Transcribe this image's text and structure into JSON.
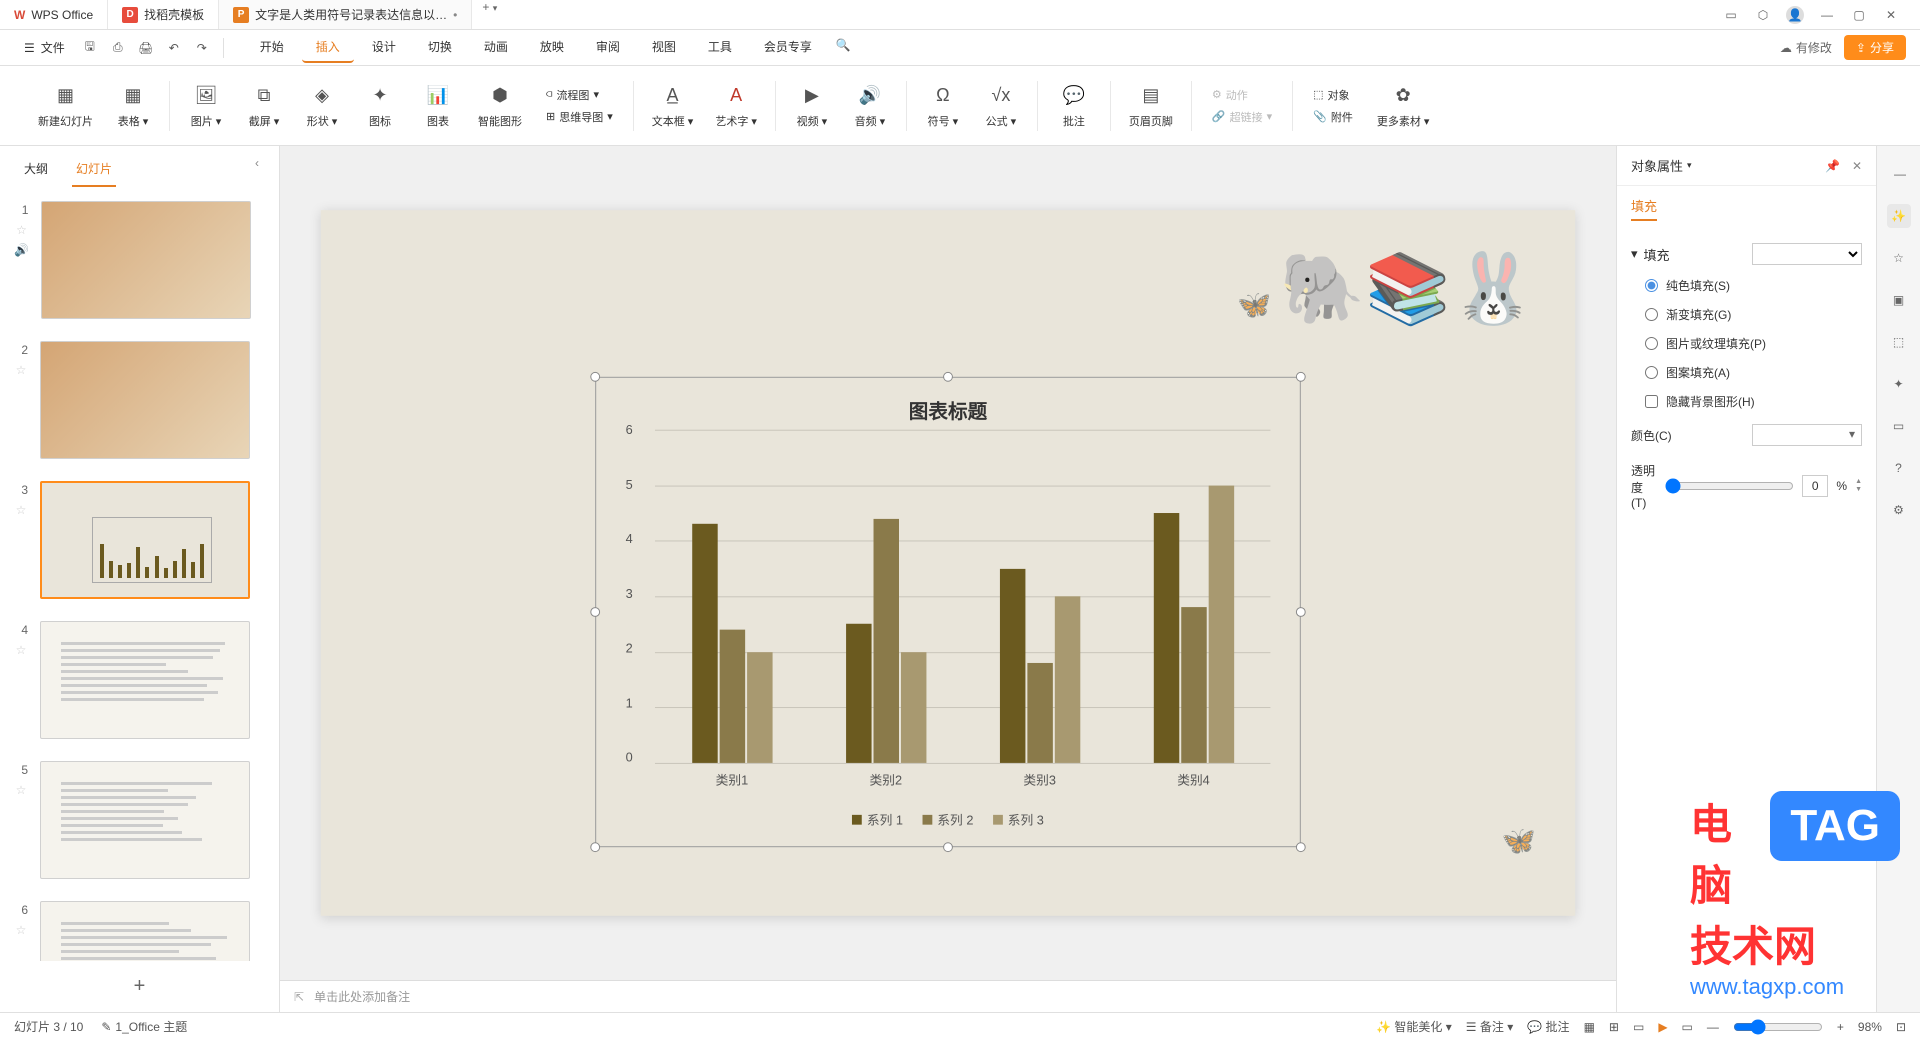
{
  "titlebar": {
    "app_name": "WPS Office",
    "tab2": "找稻壳模板",
    "tab3": "文字是人类用符号记录表达信息以…",
    "add": "+"
  },
  "menubar": {
    "file": "文件",
    "tabs": [
      "开始",
      "插入",
      "设计",
      "切换",
      "动画",
      "放映",
      "审阅",
      "视图",
      "工具",
      "会员专享"
    ],
    "active_tab": "插入",
    "has_changes": "有修改",
    "share": "分享"
  },
  "ribbon": {
    "new_slide": "新建幻灯片",
    "table": "表格",
    "picture": "图片",
    "screenshot": "截屏",
    "shape": "形状",
    "icon": "图标",
    "chart": "图表",
    "smart_graphic": "智能图形",
    "flowchart": "流程图",
    "mindmap": "思维导图",
    "textbox": "文本框",
    "wordart": "艺术字",
    "video": "视频",
    "audio": "音频",
    "symbol": "符号",
    "formula": "公式",
    "comment": "批注",
    "header_footer": "页眉页脚",
    "action": "动作",
    "hyperlink": "超链接",
    "object": "对象",
    "attachment": "附件",
    "more": "更多素材"
  },
  "thumbs": {
    "tab_outline": "大纲",
    "tab_slides": "幻灯片",
    "slides": [
      1,
      2,
      3,
      4,
      5,
      6
    ],
    "selected": 3
  },
  "notes_placeholder": "单击此处添加备注",
  "props": {
    "title": "对象属性",
    "fill_tab": "填充",
    "section_fill": "填充",
    "radio_solid": "纯色填充(S)",
    "radio_gradient": "渐变填充(G)",
    "radio_picture": "图片或纹理填充(P)",
    "radio_pattern": "图案填充(A)",
    "check_hide": "隐藏背景图形(H)",
    "color_label": "颜色(C)",
    "opacity_label": "透明度(T)",
    "opacity_value": "0",
    "opacity_unit": "%"
  },
  "statusbar": {
    "slide_info": "幻灯片 3 / 10",
    "theme": "1_Office 主题",
    "smart_beauty": "智能美化",
    "notes": "备注",
    "comments": "批注",
    "zoom": "98%"
  },
  "chart_data": {
    "type": "bar",
    "title": "图表标题",
    "categories": [
      "类别1",
      "类别2",
      "类别3",
      "类别4"
    ],
    "series": [
      {
        "name": "系列 1",
        "values": [
          4.3,
          2.5,
          3.5,
          4.5
        ]
      },
      {
        "name": "系列 2",
        "values": [
          2.4,
          4.4,
          1.8,
          2.8
        ]
      },
      {
        "name": "系列 3",
        "values": [
          2.0,
          2.0,
          3.0,
          5.0
        ]
      }
    ],
    "ylim": [
      0,
      6
    ],
    "y_ticks": [
      0,
      1,
      2,
      3,
      4,
      5,
      6
    ],
    "legend_position": "bottom"
  },
  "watermark": {
    "text": "电脑技术网",
    "url": "www.tagxp.com",
    "tag": "TAG"
  }
}
